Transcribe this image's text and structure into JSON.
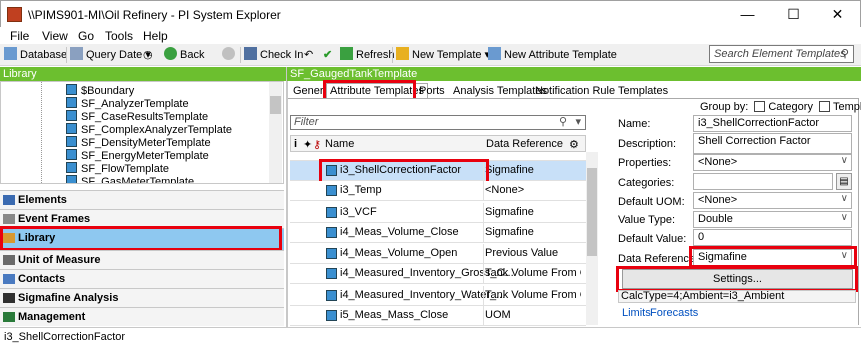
{
  "window": {
    "title": "\\\\PIMS901-MI\\Oil Refinery - PI System Explorer",
    "minimize": "—",
    "maximize": "☐",
    "close": "✕"
  },
  "menu": [
    "File",
    "View",
    "Go",
    "Tools",
    "Help"
  ],
  "toolbar": {
    "database": "Database",
    "query_date": "Query Date",
    "back": "Back",
    "check_in": "Check In",
    "refresh": "Refresh",
    "new_template": "New Template",
    "new_attribute_template": "New Attribute Template",
    "search_placeholder": "Search Element Templates"
  },
  "left": {
    "header": "Library",
    "tree_items": [
      "$Boundary",
      "SF_AnalyzerTemplate",
      "SF_CaseResultsTemplate",
      "SF_ComplexAnalyzerTemplate",
      "SF_DensityMeterTemplate",
      "SF_EnergyMeterTemplate",
      "SF_FlowTemplate",
      "SF_GasMeterTemplate"
    ],
    "nav": [
      "Elements",
      "Event Frames",
      "Library",
      "Unit of Measure",
      "Contacts",
      "Sigmafine Analysis",
      "Management"
    ]
  },
  "status": "i3_ShellCorrectionFactor",
  "right": {
    "header": "SF_GaugedTankTemplate",
    "tabs": [
      "General",
      "Attribute Templates",
      "Ports",
      "Analysis Templates",
      "Notification Rule Templates"
    ],
    "group_by": "Group by:",
    "group_category": "Category",
    "group_template": "Template",
    "filter_placeholder": "Filter",
    "grid_headers": {
      "name": "Name",
      "reference": "Data Reference"
    },
    "rows": [
      {
        "name": "i3_ShellCorrectionFactor",
        "ref": "Sigmafine"
      },
      {
        "name": "i3_Temp",
        "ref": "<None>"
      },
      {
        "name": "i3_VCF",
        "ref": "Sigmafine"
      },
      {
        "name": "i4_Meas_Volume_Close",
        "ref": "Sigmafine"
      },
      {
        "name": "i4_Meas_Volume_Open",
        "ref": "Previous Value"
      },
      {
        "name": "i4_Measured_Inventory_Gross_C...",
        "ref": "Tank Volume From Ga..."
      },
      {
        "name": "i4_Measured_Inventory_Water_...",
        "ref": "Tank Volume From Ga..."
      },
      {
        "name": "i5_Meas_Mass_Close",
        "ref": "UOM"
      }
    ],
    "props": {
      "name_label": "Name:",
      "name_value": "i3_ShellCorrectionFactor",
      "desc_label": "Description:",
      "desc_value": "Shell Correction Factor",
      "properties_label": "Properties:",
      "properties_value": "<None>",
      "categories_label": "Categories:",
      "categories_value": "",
      "uom_label": "Default UOM:",
      "uom_value": "<None>",
      "type_label": "Value Type:",
      "type_value": "Double",
      "default_label": "Default Value:",
      "default_value": "0",
      "dataref_label": "Data Reference:",
      "dataref_value": "Sigmafine",
      "settings_button": "Settings...",
      "calc_text": "CalcType=4;Ambient=i3_Ambient",
      "limits_link": "Limits",
      "forecasts_link": "Forecasts"
    }
  }
}
